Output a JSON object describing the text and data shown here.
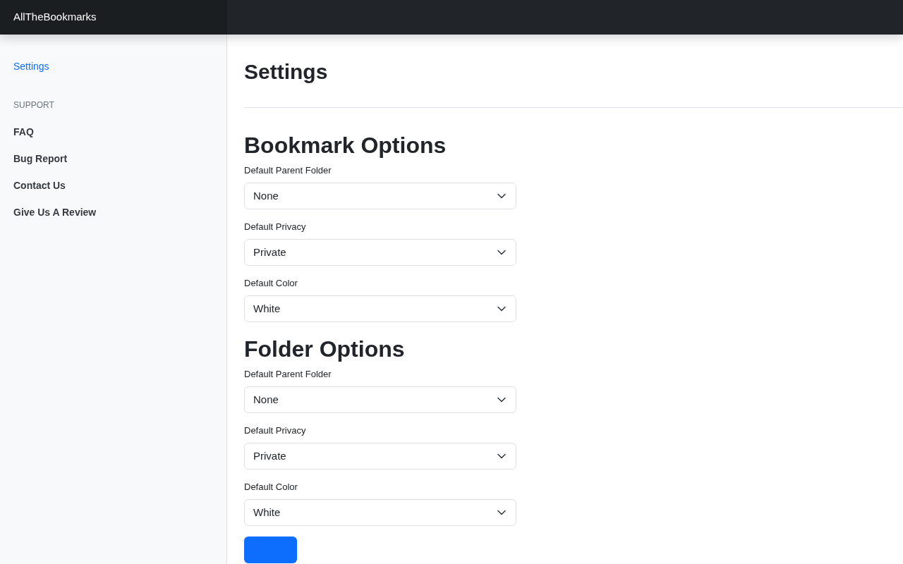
{
  "brand": "AllTheBookmarks",
  "sidebar": {
    "groups": [
      {
        "items": [
          {
            "label": "Settings",
            "selected": true
          }
        ]
      },
      {
        "heading": "SUPPORT",
        "items": [
          {
            "label": "FAQ",
            "selected": false
          },
          {
            "label": "Bug Report",
            "selected": false
          },
          {
            "label": "Contact Us",
            "selected": false
          },
          {
            "label": "Give Us A Review",
            "selected": false
          }
        ]
      }
    ]
  },
  "page_title": "Settings",
  "sections": [
    {
      "title": "Bookmark Options",
      "fields": [
        {
          "label": "Default Parent Folder",
          "value": "None"
        },
        {
          "label": "Default Privacy",
          "value": "Private"
        },
        {
          "label": "Default Color",
          "value": "White"
        }
      ]
    },
    {
      "title": "Folder Options",
      "fields": [
        {
          "label": "Default Parent Folder",
          "value": "None"
        },
        {
          "label": "Default Privacy",
          "value": "Private"
        },
        {
          "label": "Default Color",
          "value": "White"
        }
      ]
    }
  ]
}
